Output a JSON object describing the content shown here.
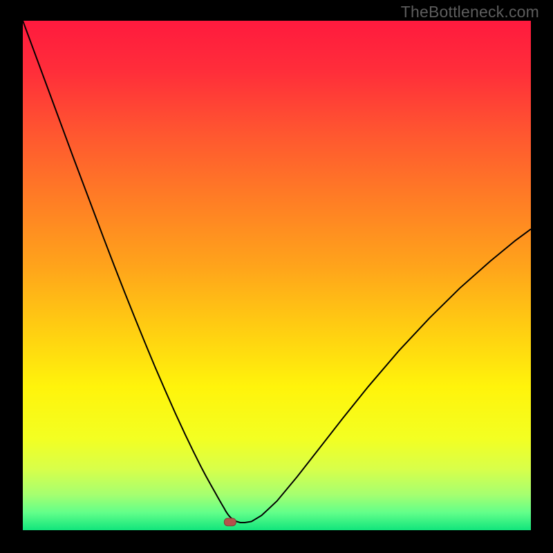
{
  "watermark": "TheBottleneck.com",
  "colors": {
    "gradient_stops": [
      {
        "offset": 0.0,
        "color": "#ff1a3e"
      },
      {
        "offset": 0.1,
        "color": "#ff2e3a"
      },
      {
        "offset": 0.22,
        "color": "#ff5630"
      },
      {
        "offset": 0.35,
        "color": "#ff7d25"
      },
      {
        "offset": 0.48,
        "color": "#ffa31b"
      },
      {
        "offset": 0.6,
        "color": "#ffcc12"
      },
      {
        "offset": 0.72,
        "color": "#fff40b"
      },
      {
        "offset": 0.82,
        "color": "#f3ff22"
      },
      {
        "offset": 0.88,
        "color": "#d8ff4a"
      },
      {
        "offset": 0.93,
        "color": "#a6ff70"
      },
      {
        "offset": 0.965,
        "color": "#63ff8a"
      },
      {
        "offset": 1.0,
        "color": "#11e57c"
      }
    ],
    "curve": "#000000",
    "marker_fill": "#b4524b",
    "marker_stroke": "#813e36"
  },
  "chart_data": {
    "type": "line",
    "title": "",
    "xlabel": "",
    "ylabel": "",
    "xlim": [
      0,
      100
    ],
    "ylim": [
      0,
      100
    ],
    "legend": false,
    "grid": false,
    "series": [
      {
        "name": "bottleneck-curve",
        "x": [
          0,
          2,
          4,
          6,
          8,
          10,
          12,
          14,
          16,
          18,
          20,
          22,
          24,
          26,
          28,
          30,
          32,
          33.5,
          35,
          36,
          37,
          37.8,
          38.3,
          38.7,
          39.1,
          39.4,
          39.7,
          39.9,
          40.1,
          40.3,
          40.6,
          41.0,
          41.5,
          42.1,
          42.8,
          43.7,
          45,
          47,
          50,
          54,
          58,
          63,
          68,
          74,
          80,
          86,
          92,
          97,
          100
        ],
        "y": [
          100,
          94.6,
          89.2,
          83.8,
          78.4,
          73.0,
          67.7,
          62.4,
          57.1,
          51.9,
          46.8,
          41.8,
          36.9,
          32.1,
          27.5,
          23.0,
          18.7,
          15.6,
          12.6,
          10.7,
          8.9,
          7.5,
          6.6,
          5.9,
          5.2,
          4.7,
          4.2,
          3.8,
          3.5,
          3.2,
          2.8,
          2.4,
          2.0,
          1.7,
          1.5,
          1.5,
          1.7,
          2.9,
          5.7,
          10.5,
          15.6,
          22.0,
          28.2,
          35.2,
          41.6,
          47.5,
          52.8,
          56.9,
          59.1
        ]
      }
    ],
    "marker": {
      "x": 40.8,
      "y": 1.6
    }
  }
}
